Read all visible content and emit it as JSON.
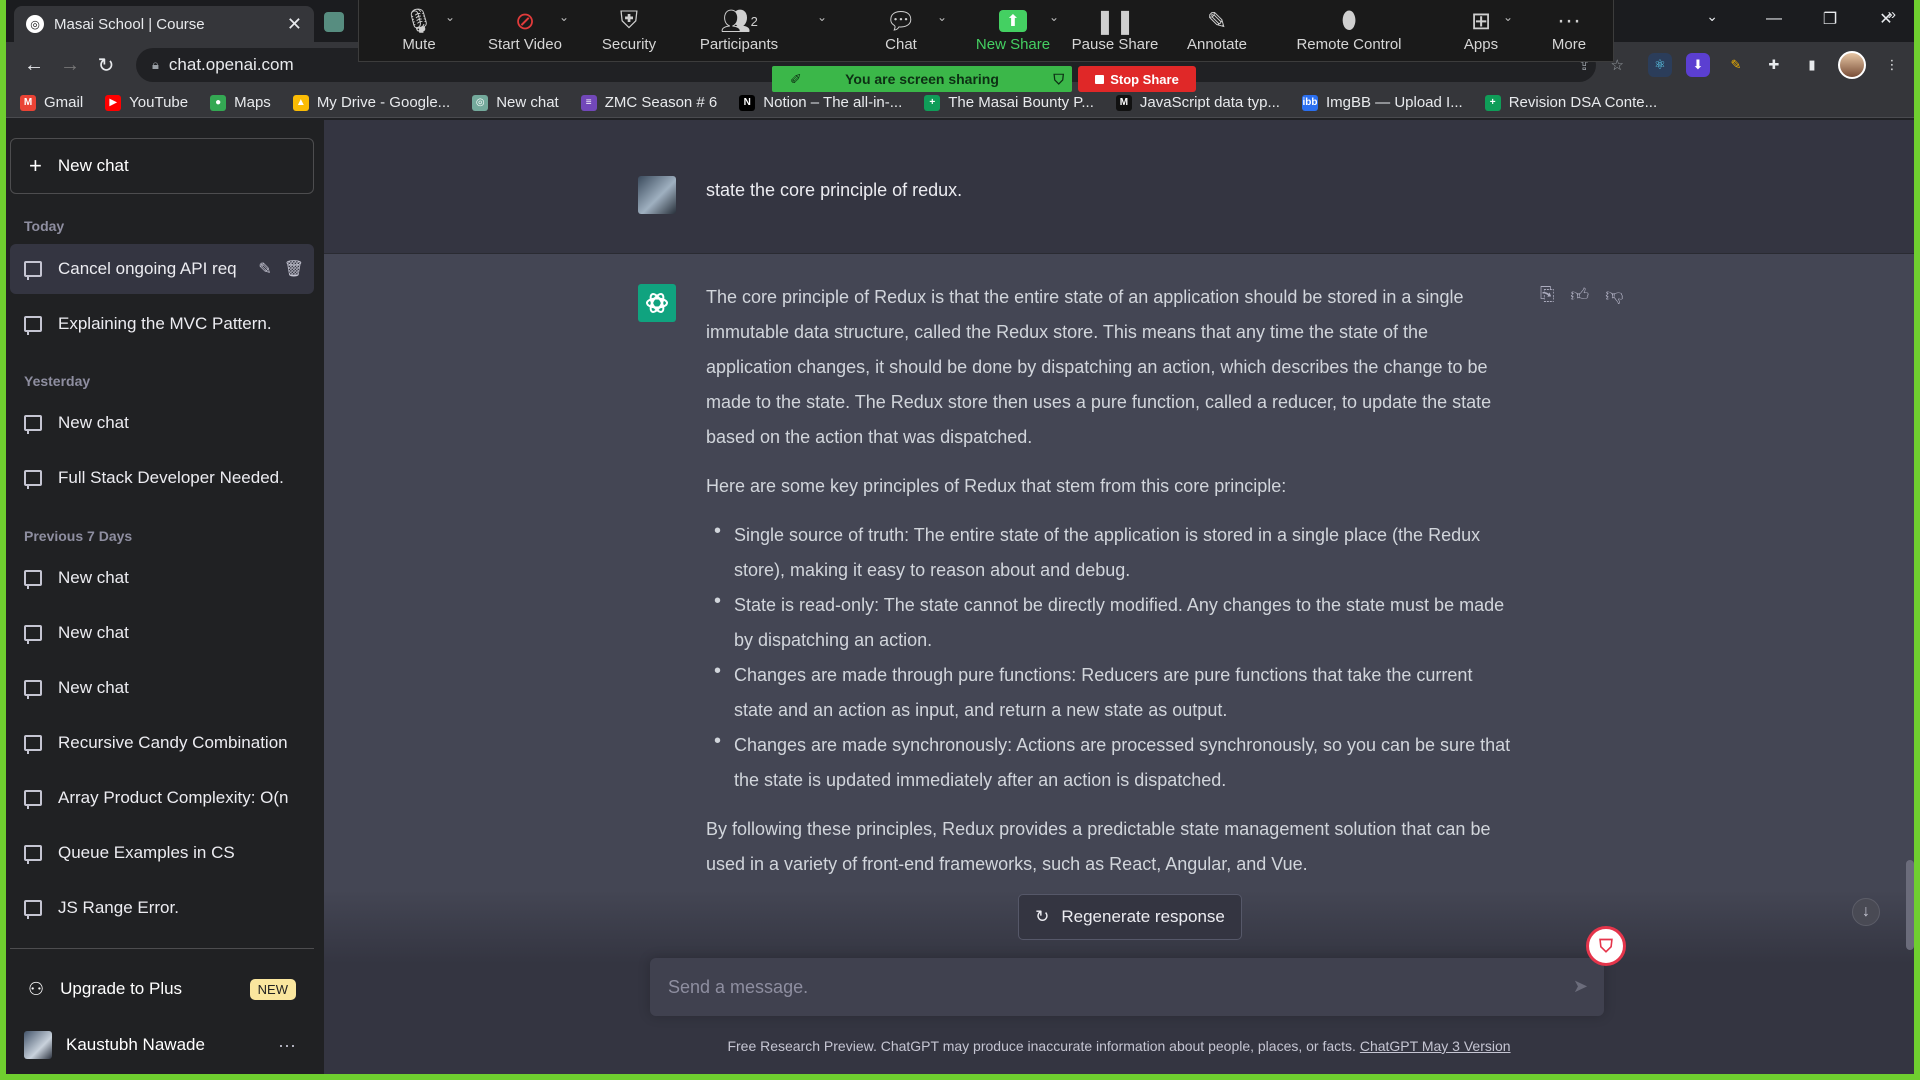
{
  "browser": {
    "tab_title": "Masai School | Course",
    "url": "chat.openai.com"
  },
  "bookmarks": [
    {
      "label": "Gmail",
      "icon": "gmail-icon",
      "color": "#ea4335",
      "glyph": "M"
    },
    {
      "label": "YouTube",
      "icon": "youtube-icon",
      "color": "#ff0000",
      "glyph": "▶"
    },
    {
      "label": "Maps",
      "icon": "maps-icon",
      "color": "#34a853",
      "glyph": "●"
    },
    {
      "label": "My Drive - Google...",
      "icon": "drive-icon",
      "color": "#fbbc04",
      "glyph": "▲"
    },
    {
      "label": "New chat",
      "icon": "chatgpt-icon",
      "color": "#74aa9c",
      "glyph": "◎"
    },
    {
      "label": "ZMC Season # 6",
      "icon": "list-icon",
      "color": "#7248b9",
      "glyph": "≡"
    },
    {
      "label": "Notion – The all-in-...",
      "icon": "notion-icon",
      "color": "#000000",
      "glyph": "N"
    },
    {
      "label": "The Masai Bounty P...",
      "icon": "plus-icon",
      "color": "#0f9d58",
      "glyph": "+"
    },
    {
      "label": "JavaScript data typ...",
      "icon": "medium-icon",
      "color": "#111111",
      "glyph": "M"
    },
    {
      "label": "ImgBB — Upload I...",
      "icon": "imgbb-icon",
      "color": "#2a6ff0",
      "glyph": "ibb"
    },
    {
      "label": "Revision DSA Conte...",
      "icon": "plus-icon",
      "color": "#0f9d58",
      "glyph": "+"
    }
  ],
  "zoom": {
    "mute": "Mute",
    "start_video": "Start Video",
    "security": "Security",
    "participants": "Participants",
    "participants_count": "2",
    "chat": "Chat",
    "new_share": "New Share",
    "pause_share": "Pause Share",
    "annotate": "Annotate",
    "remote_control": "Remote Control",
    "apps": "Apps",
    "more": "More",
    "sharing_banner": "You are screen sharing",
    "stop_share": "Stop Share"
  },
  "sidebar": {
    "new_chat": "New chat",
    "sections": {
      "today": "Today",
      "yesterday": "Yesterday",
      "previous7": "Previous 7 Days"
    },
    "items": [
      {
        "label": "Cancel ongoing API req"
      },
      {
        "label": "Explaining the MVC Pattern."
      },
      {
        "label": "New chat"
      },
      {
        "label": "Full Stack Developer Needed."
      },
      {
        "label": "New chat"
      },
      {
        "label": "New chat"
      },
      {
        "label": "New chat"
      },
      {
        "label": "Recursive Candy Combination"
      },
      {
        "label": "Array Product Complexity: O(n"
      },
      {
        "label": "Queue Examples in CS"
      },
      {
        "label": "JS Range Error."
      }
    ],
    "upgrade": "Upgrade to Plus",
    "upgrade_badge": "NEW",
    "user_name": "Kaustubh Nawade"
  },
  "conversation": {
    "user_prompt": "state the core principle of redux.",
    "response_p1": "The core principle of Redux is that the entire state of an application should be stored in a single immutable data structure, called the Redux store. This means that any time the state of the application changes, it should be done by dispatching an action, which describes the change to be made to the state. The Redux store then uses a pure function, called a reducer, to update the state based on the action that was dispatched.",
    "response_p2": "Here are some key principles of Redux that stem from this core principle:",
    "bullets": [
      "Single source of truth: The entire state of the application is stored in a single place (the Redux store), making it easy to reason about and debug.",
      "State is read-only: The state cannot be directly modified. Any changes to the state must be made by dispatching an action.",
      "Changes are made through pure functions: Reducers are pure functions that take the current state and an action as input, and return a new state as output.",
      "Changes are made synchronously: Actions are processed synchronously, so you can be sure that the state is updated immediately after an action is dispatched."
    ],
    "response_p3": "By following these principles, Redux provides a predictable state management solution that can be used in a variety of front-end frameworks, such as React, Angular, and Vue."
  },
  "composer": {
    "regenerate": "Regenerate response",
    "placeholder": "Send a message."
  },
  "footer": {
    "text": "Free Research Preview. ChatGPT may produce inaccurate information about people, places, or facts. ",
    "link": "ChatGPT May 3 Version"
  },
  "colors": {
    "accent": "#10a37f",
    "share_green": "#3bb749",
    "stop_red": "#e02828",
    "window_border": "#6fcf2f"
  }
}
